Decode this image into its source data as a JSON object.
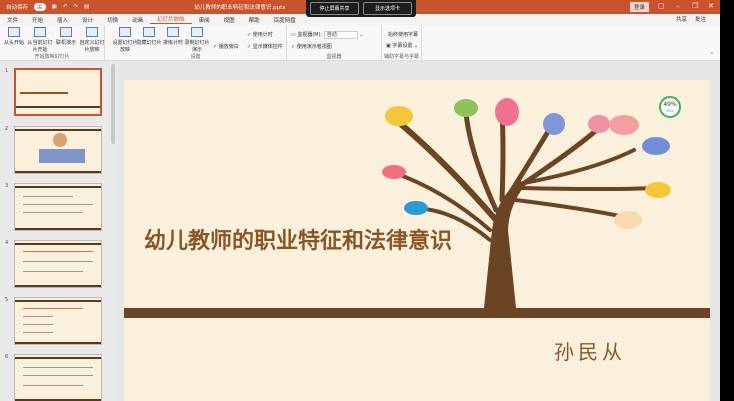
{
  "titlebar": {
    "autosave": "自动保存",
    "autosave_state": "关",
    "title": "幼儿教师的职业特征和法律意识.pptx",
    "login": "登录"
  },
  "overlay": {
    "stop_share": "停止屏幕共享",
    "show_tabs": "显示选项卡"
  },
  "tabs": [
    "文件",
    "开始",
    "插入",
    "设计",
    "切换",
    "动画",
    "幻灯片放映",
    "审阅",
    "视图",
    "帮助",
    "百度网盘"
  ],
  "share": {
    "share": "共享",
    "comment": "批注"
  },
  "ribbon": {
    "start_group": {
      "label": "开始放映幻灯片",
      "buttons": [
        "从头开始",
        "从当前幻灯片开始",
        "联机演示",
        "自定义幻灯片放映"
      ]
    },
    "setup_group": {
      "label": "设置",
      "buttons": [
        "设置幻灯片放映",
        "隐藏幻灯片",
        "排练计时",
        "录制幻灯片演示"
      ],
      "checks": [
        "播放旁白",
        "使用计时",
        "显示媒体控件"
      ]
    },
    "monitor_group": {
      "label": "监视器",
      "monitor": "监视器(M):",
      "monitor_value": "自动",
      "presenter": "使用演示者视图"
    },
    "caption_group": {
      "label": "辅助字幕与字幕",
      "always": "始终使用字幕",
      "settings": "字幕设置"
    }
  },
  "thumbnails": [
    "1",
    "2",
    "3",
    "4",
    "5",
    "6"
  ],
  "slide": {
    "title": "幼儿教师的职业特征和法律意识",
    "author": "孙民从"
  },
  "badge": {
    "percent": "49%",
    "speed": "0K/s"
  },
  "colors": {
    "accent": "#c9532c",
    "slide_bg": "#fbf0dc",
    "brown": "#6b4423"
  }
}
